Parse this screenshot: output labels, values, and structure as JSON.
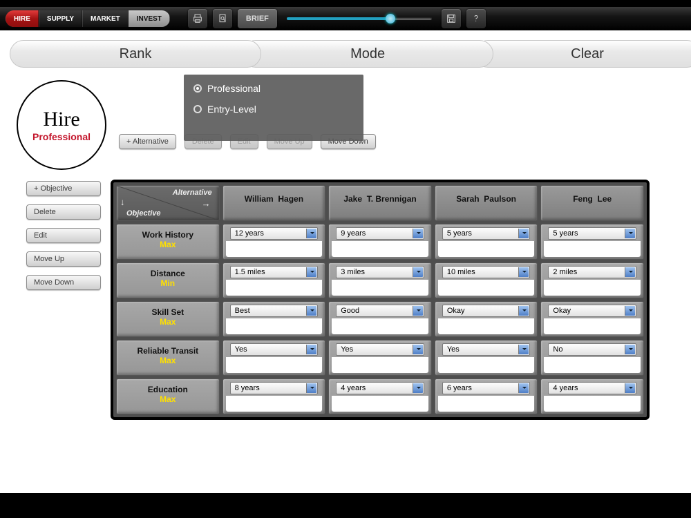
{
  "toolbar": {
    "tabs": [
      "HIRE",
      "SUPPLY",
      "MARKET",
      "INVEST"
    ],
    "active_tab": "HIRE",
    "brief_label": "BRIEF",
    "slider_value": 0.7
  },
  "wizard": {
    "rank": "Rank",
    "mode": "Mode",
    "clear": "Clear"
  },
  "hire": {
    "title": "Hire",
    "subtitle": "Professional",
    "options": {
      "professional": "Professional",
      "entry": "Entry-Level",
      "selected": "professional"
    }
  },
  "alt_buttons": {
    "add": "+ Alternative",
    "delete": "Delete",
    "edit": "Edit",
    "moveup": "Move Up",
    "movedown": "Move Down"
  },
  "obj_buttons": {
    "add": "+ Objective",
    "delete": "Delete",
    "edit": "Edit",
    "moveup": "Move Up",
    "movedown": "Move Down"
  },
  "table": {
    "corner_alt": "Alternative",
    "corner_obj": "Objective",
    "alternatives": [
      "William  Hagen",
      "Jake  T. Brennigan",
      "Sarah  Paulson",
      "Feng  Lee"
    ],
    "objectives": [
      {
        "name": "Work  History",
        "mode": "Max"
      },
      {
        "name": "Distance",
        "mode": "Min"
      },
      {
        "name": "Skill  Set",
        "mode": "Max"
      },
      {
        "name": "Reliable  Transit",
        "mode": "Max"
      },
      {
        "name": "Education",
        "mode": "Max"
      }
    ],
    "values": [
      [
        "12 years",
        "9 years",
        "5 years",
        "5 years"
      ],
      [
        "1.5 miles",
        "3 miles",
        "10 miles",
        "2 miles"
      ],
      [
        "Best",
        "Good",
        "Okay",
        "Okay"
      ],
      [
        "Yes",
        "Yes",
        "Yes",
        "No"
      ],
      [
        "8 years",
        "4 years",
        "6 years",
        "4 years"
      ]
    ]
  }
}
